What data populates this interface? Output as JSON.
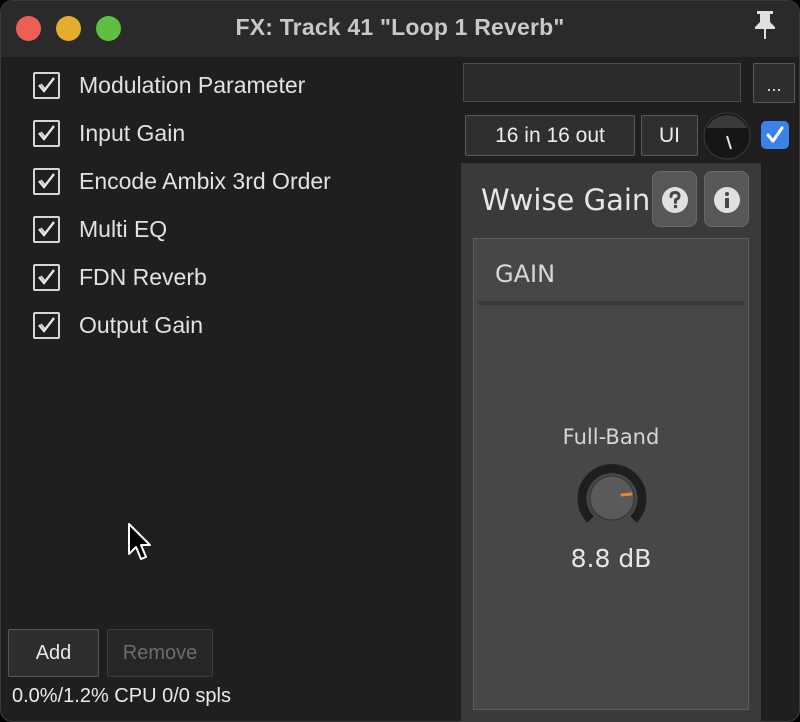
{
  "window": {
    "title": "FX: Track 41 \"Loop 1 Reverb\"",
    "pin_icon": "pin-icon"
  },
  "fx_chain": {
    "items": [
      {
        "label": "Modulation Parameter",
        "checked": true
      },
      {
        "label": "Input Gain",
        "checked": true
      },
      {
        "label": "Encode Ambix 3rd Order",
        "checked": true
      },
      {
        "label": "Multi EQ",
        "checked": true
      },
      {
        "label": "FDN Reverb",
        "checked": true
      },
      {
        "label": "Output Gain",
        "checked": true
      }
    ],
    "add_label": "Add",
    "remove_label": "Remove",
    "cpu_status": "0.0%/1.2% CPU 0/0 spls"
  },
  "plugin_controls": {
    "preset_value": "",
    "more_label": "...",
    "io_label": "16 in 16 out",
    "ui_label": "UI",
    "enabled": true
  },
  "plugin": {
    "name": "Wwise Gain",
    "help_icon": "question-icon",
    "info_icon": "info-icon",
    "section_title": "GAIN",
    "knob_label": "Full-Band",
    "knob_value": "8.8 dB"
  },
  "colors": {
    "accent_blue": "#3b82e8",
    "knob_indicator": "#e0893a",
    "close": "#ec5f57",
    "minimize": "#e3ad2f",
    "maximize": "#5ec03f"
  }
}
